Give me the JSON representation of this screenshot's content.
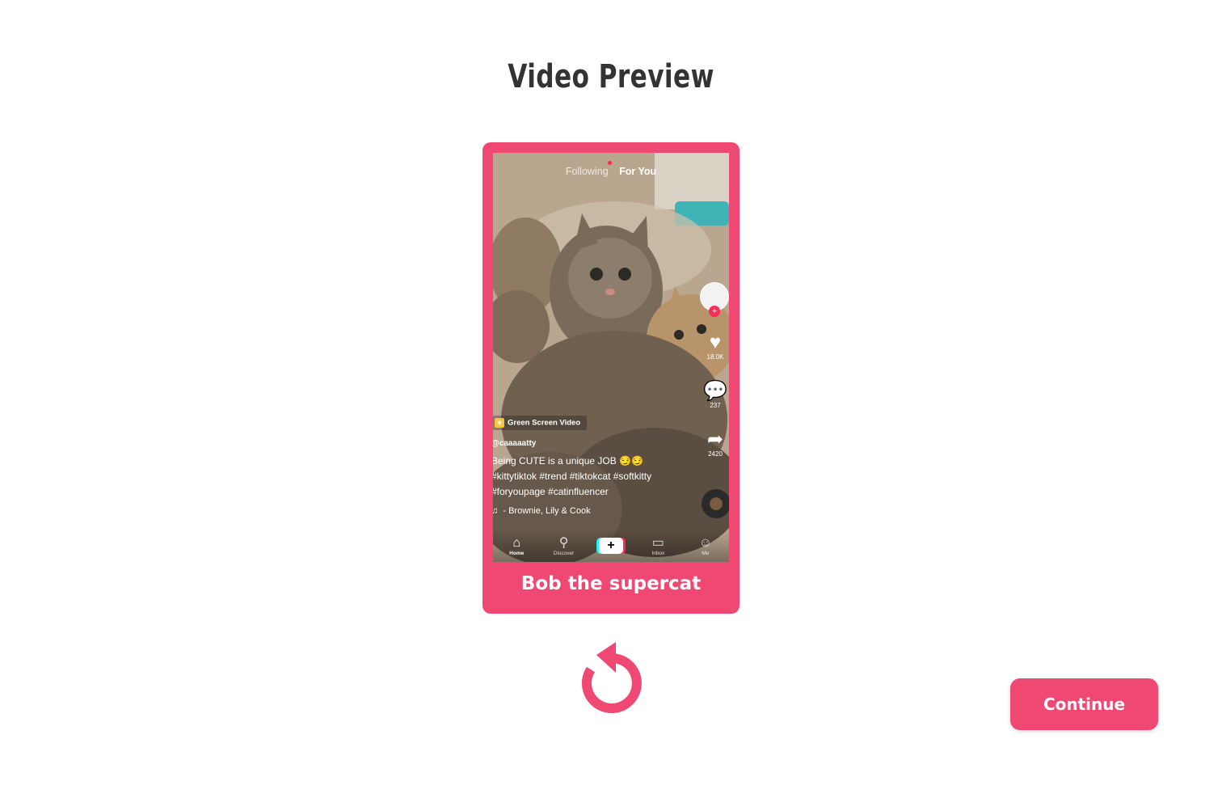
{
  "page": {
    "title": "Video Preview",
    "continue_label": "Continue",
    "accent_color": "#ef4873"
  },
  "preview_card": {
    "caption": "Bob the supercat",
    "phone": {
      "tabs": {
        "following": "Following",
        "for_you": "For You"
      },
      "effect_badge": "Green Screen Video",
      "username": "@caaaaatty",
      "caption_line1": "Being CUTE is a unique JOB 😏😏",
      "caption_line2": "#kittytiktok #trend #tiktokcat #softkitty",
      "caption_line3": "#foryoupage #catinfluencer",
      "music": "- Brownie, Lily & Cook",
      "likes": "18.0K",
      "comments": "237",
      "shares": "2420",
      "nav": {
        "home": "Home",
        "discover": "Discover",
        "inbox": "Inbox",
        "me": "Me"
      }
    }
  },
  "icons": {
    "replay": "replay-icon",
    "heart": "heart-icon",
    "comment": "comment-icon",
    "share": "share-icon",
    "music": "music-note-icon"
  }
}
